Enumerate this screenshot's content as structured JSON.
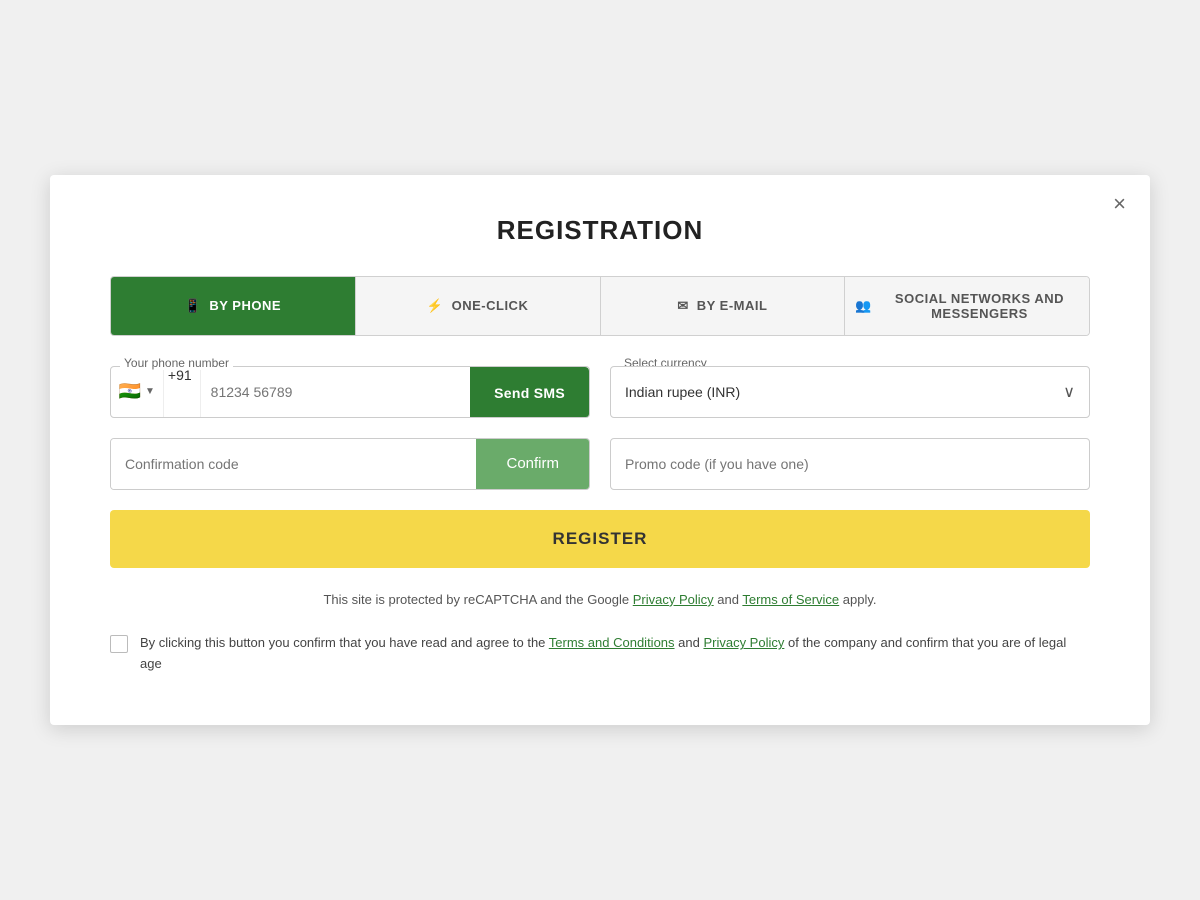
{
  "modal": {
    "title": "REGISTRATION",
    "close_label": "×"
  },
  "tabs": [
    {
      "id": "by-phone",
      "label": "BY PHONE",
      "icon": "📱",
      "active": true
    },
    {
      "id": "one-click",
      "label": "ONE-CLICK",
      "icon": "⚡",
      "active": false
    },
    {
      "id": "by-email",
      "label": "BY E-MAIL",
      "icon": "✉",
      "active": false
    },
    {
      "id": "social",
      "label": "SOCIAL NETWORKS AND MESSENGERS",
      "icon": "👥",
      "active": false
    }
  ],
  "phone_field": {
    "label": "Your phone number",
    "country_flag": "🇮🇳",
    "country_code": "+91",
    "placeholder": "81234 56789",
    "send_sms_label": "Send SMS"
  },
  "currency_field": {
    "label": "Select currency",
    "value": "Indian rupee (INR)"
  },
  "confirmation_field": {
    "placeholder": "Confirmation code",
    "confirm_label": "Confirm"
  },
  "promo_field": {
    "placeholder": "Promo code (if you have one)"
  },
  "register_button": {
    "label": "REGISTER"
  },
  "recaptcha_text": {
    "prefix": "This site is protected by reCAPTCHA and the Google ",
    "privacy_policy": "Privacy Policy",
    "and": " and ",
    "terms_of_service": "Terms of Service",
    "suffix": " apply."
  },
  "terms": {
    "text_prefix": "By clicking this button you confirm that you have read and agree to the ",
    "terms_link": "Terms and Conditions",
    "text_middle": " and ",
    "privacy_link": "Privacy Policy",
    "text_suffix": " of the company and confirm that you are of legal age"
  },
  "colors": {
    "green_primary": "#2e7d32",
    "green_light": "#6aab6a",
    "yellow": "#f5d849",
    "tab_bg": "#f5f5f5"
  }
}
